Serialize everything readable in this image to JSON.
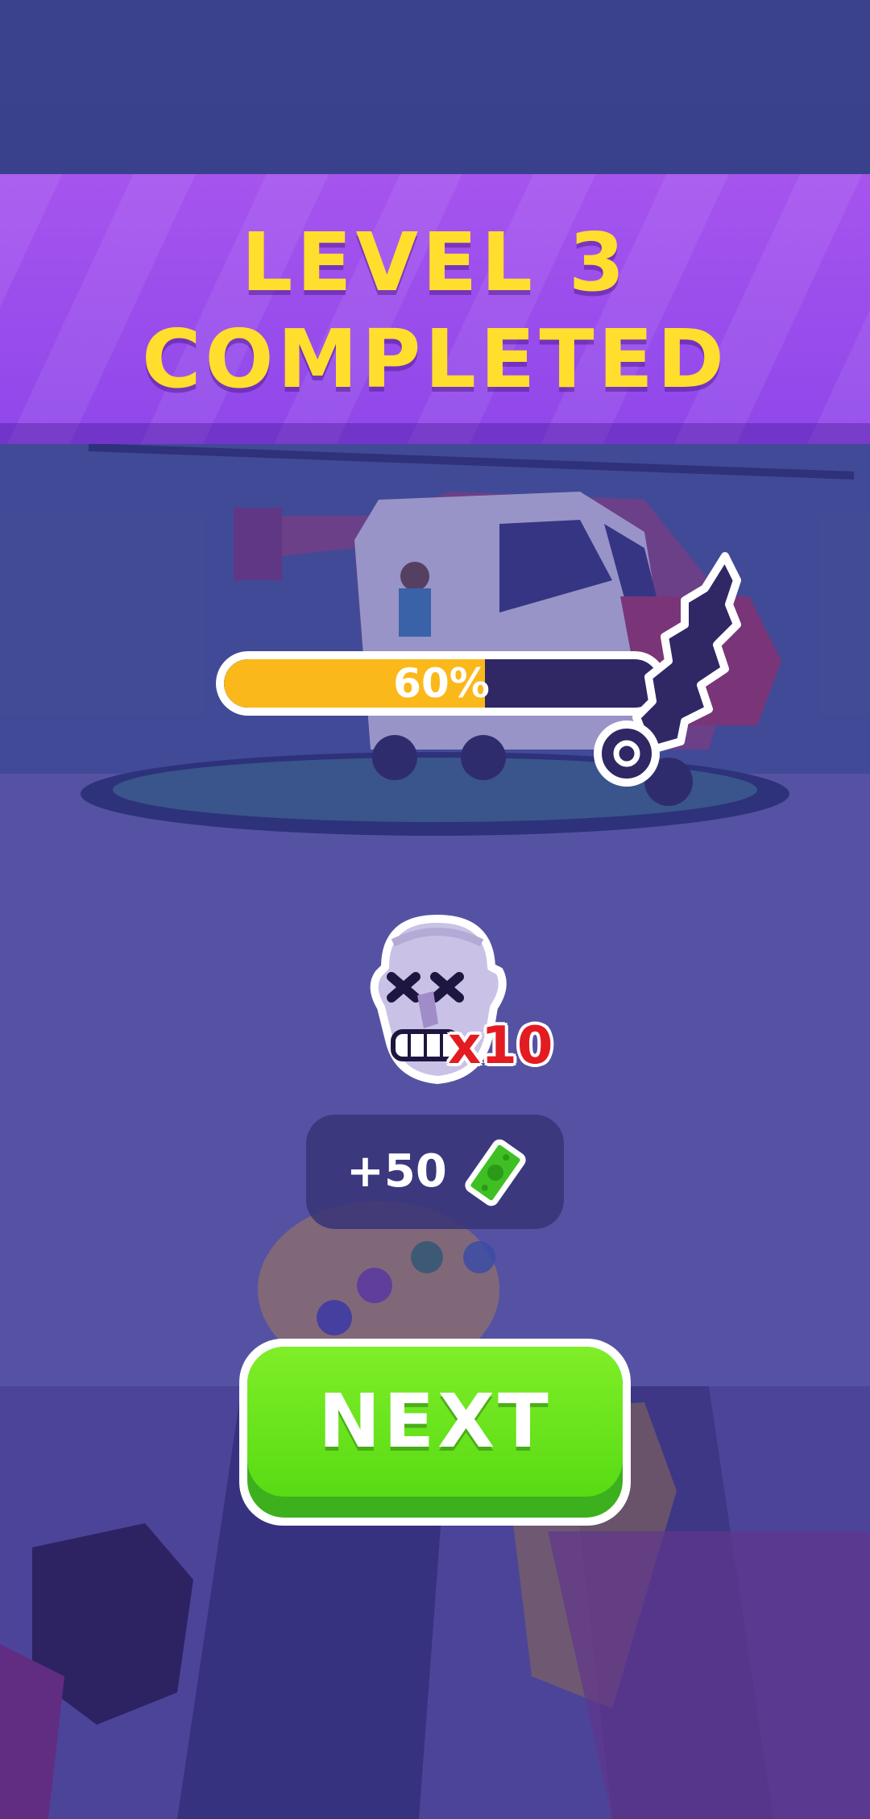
{
  "banner": {
    "line1": "LEVEL 3",
    "line2": "COMPLETED"
  },
  "progress": {
    "value": 0.6,
    "label": "60%"
  },
  "kills": {
    "count_label": "x10",
    "icon": "dead-face-icon"
  },
  "reward": {
    "amount_label": "+50",
    "icon": "cash-icon"
  },
  "next_button": {
    "label": "NEXT"
  },
  "colors": {
    "banner": "#9d4fee",
    "banner_text": "#ffde2e",
    "progress_fill": "#fbb81b",
    "progress_track": "#302765",
    "button_green": "#5de016",
    "kill_red": "#e31c22"
  }
}
